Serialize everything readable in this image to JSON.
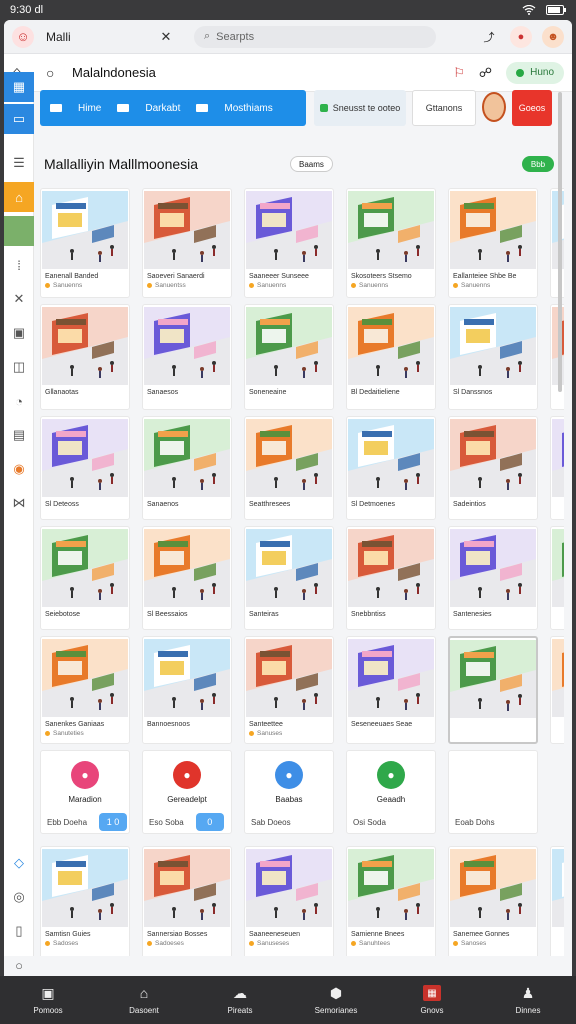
{
  "status_bar": {
    "time": "9:30 dl",
    "icons": [
      "wifi-icon",
      "battery-icon"
    ]
  },
  "browser": {
    "tab_title": "Malli",
    "search_placeholder": "Searpts",
    "url": "Malalndonesia",
    "green_pill": "Huno"
  },
  "banner": {
    "items": [
      "Hime",
      "Darkabt",
      "Mosthiams"
    ],
    "card_button_1": "Sneusst te ooteo",
    "card_button_2": "Gttanons",
    "card_button_3": "Goeos"
  },
  "page": {
    "title": "Mallalliyin Malllmoonesia",
    "small_button": "Baams",
    "green_button": "Bbb"
  },
  "cards_row1": [
    {
      "caption": "Eanenall Banded",
      "meta": "Sanuenns"
    },
    {
      "caption": "Saoeveri Sanaerdi",
      "meta": "Sanuentss"
    },
    {
      "caption": "Saaneeer Sunseee",
      "meta": "Sanuenns"
    },
    {
      "caption": "Skosoteers Stsemo",
      "meta": "Sanuenns"
    },
    {
      "caption": "Eallanteiee Shbe Be",
      "meta": "Sanuenns"
    }
  ],
  "cards_row2": [
    {
      "caption": "Gllanaotas"
    },
    {
      "caption": "Sanaesos"
    },
    {
      "caption": "Soneneaine"
    },
    {
      "caption": "Bl Dedaitieliene"
    },
    {
      "caption": "Sl Danssnos"
    }
  ],
  "cards_row3": [
    {
      "caption": "Sl Deteoss"
    },
    {
      "caption": "Sanaenos"
    },
    {
      "caption": "Seatthresees"
    },
    {
      "caption": "Sl Detmoenes"
    },
    {
      "caption": "Sadeintios"
    }
  ],
  "cards_row4": [
    {
      "caption": "Seiebotose"
    },
    {
      "caption": "Sl Beessaios"
    },
    {
      "caption": "Santeiras"
    },
    {
      "caption": "Snebbntiss"
    },
    {
      "caption": "Santenesies"
    }
  ],
  "cards_row5": [
    {
      "caption": "Sanenkes Ganiaas",
      "meta": "Sanuteties"
    },
    {
      "caption": "Bannoesnoos"
    },
    {
      "caption": "Santeettee",
      "meta": "Sanuses"
    },
    {
      "caption": "Seseneeuaes Seae"
    },
    {
      "caption": ""
    }
  ],
  "services": [
    {
      "label": "Maradion",
      "price": "Ebb Doeha",
      "stepper": "1 0"
    },
    {
      "label": "Gereadelpt",
      "price": "Eso Soba",
      "stepper": "0"
    },
    {
      "label": "Baabas",
      "price": "Sab Doeos"
    },
    {
      "label": "Geaadh",
      "price": "Osi Soda"
    },
    {
      "label": "",
      "price": "Eoab Dohs"
    }
  ],
  "cards_row6": [
    {
      "caption": "Samtisn Guies",
      "meta": "Sadoses"
    },
    {
      "caption": "Sannersiao Bosses",
      "meta": "Sadoeses"
    },
    {
      "caption": "Saaneeneseuen",
      "meta": "Sanuseses"
    },
    {
      "caption": "Samienne Bnees",
      "meta": "Sanuhtees"
    },
    {
      "caption": "Sanemee Gonnes",
      "meta": "Sanoses"
    }
  ],
  "bottom_nav": [
    "Pomoos",
    "Dasoent",
    "Pireats",
    "Semorianes",
    "Gnovs",
    "Dinnes"
  ],
  "colors": {
    "accent": "#1e8ee8",
    "danger": "#e8352b",
    "success": "#2fb24c"
  }
}
